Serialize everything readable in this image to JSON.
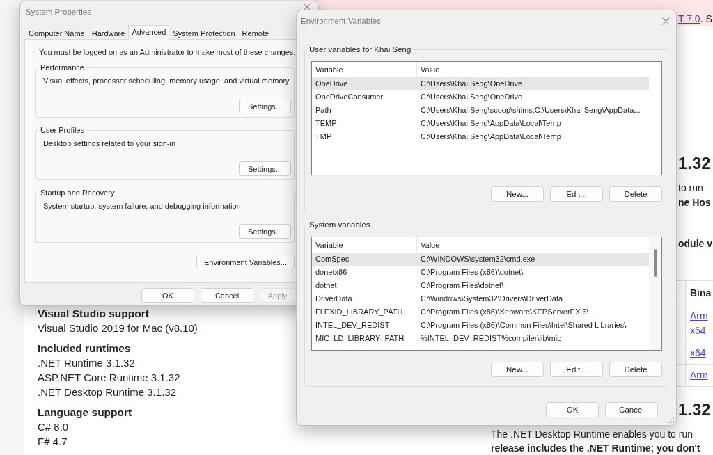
{
  "web_page": {
    "banner": {
      "link": "T 7.0",
      "text": ". S"
    },
    "left_column": [
      {
        "kind": "heading",
        "text": "Visual Studio support"
      },
      {
        "kind": "text",
        "text": "Visual Studio 2019 for Mac (v8.10)"
      },
      {
        "kind": "heading",
        "text": "Included runtimes"
      },
      {
        "kind": "text",
        "text": ".NET Runtime 3.1.32"
      },
      {
        "kind": "text",
        "text": "ASP.NET Core Runtime 3.1.32"
      },
      {
        "kind": "text",
        "text": ".NET Desktop Runtime 3.1.32"
      },
      {
        "kind": "heading",
        "text": "Language support"
      },
      {
        "kind": "text",
        "text": "C# 8.0"
      },
      {
        "kind": "text",
        "text": "F# 4.7"
      }
    ],
    "right_column": [
      {
        "kind": "title",
        "text": "1.32"
      },
      {
        "kind": "text",
        "text": "to run"
      },
      {
        "kind": "bold",
        "text": "ne Hos"
      },
      {
        "kind": "bold",
        "text": "odule v"
      },
      {
        "kind": "table",
        "columns": [
          "Bina"
        ],
        "rows": [
          [
            "Arm",
            "x64"
          ],
          [
            "x64"
          ],
          [
            "Arm"
          ]
        ]
      },
      {
        "kind": "title",
        "text": "1.32"
      }
    ],
    "bottom_lines": [
      {
        "kind": "text",
        "text": "The .NET Desktop Runtime enables you to run"
      },
      {
        "kind": "bold",
        "text": "release includes the .NET Runtime; you don't"
      }
    ]
  },
  "system_properties": {
    "title": "System Properties",
    "tabs": [
      {
        "label": "Computer Name",
        "selected": false
      },
      {
        "label": "Hardware",
        "selected": false
      },
      {
        "label": "Advanced",
        "selected": true
      },
      {
        "label": "System Protection",
        "selected": false
      },
      {
        "label": "Remote",
        "selected": false
      }
    ],
    "notice": "You must be logged on as an Administrator to make most of these changes.",
    "groups": [
      {
        "title": "Performance",
        "description": "Visual effects, processor scheduling, memory usage, and virtual memory",
        "button": "Settings..."
      },
      {
        "title": "User Profiles",
        "description": "Desktop settings related to your sign-in",
        "button": "Settings..."
      },
      {
        "title": "Startup and Recovery",
        "description": "System startup, system failure, and debugging information",
        "button": "Settings..."
      }
    ],
    "panel_button": "Environment Variables...",
    "buttons": [
      {
        "label": "OK",
        "disabled": false
      },
      {
        "label": "Cancel",
        "disabled": false
      },
      {
        "label": "Apply",
        "disabled": true
      }
    ]
  },
  "environment_variables": {
    "title": "Environment Variables",
    "sections": [
      {
        "title": "User variables for Khai Seng",
        "columns": [
          "Variable",
          "Value"
        ],
        "scrollable": false,
        "rows": [
          {
            "variable": "OneDrive",
            "value": "C:\\Users\\Khai Seng\\OneDrive",
            "selected": true
          },
          {
            "variable": "OneDriveConsumer",
            "value": "C:\\Users\\Khai Seng\\OneDrive",
            "selected": false
          },
          {
            "variable": "Path",
            "value": "C:\\Users\\Khai Seng\\scoop\\shims;C:\\Users\\Khai Seng\\AppData...",
            "selected": false
          },
          {
            "variable": "TEMP",
            "value": "C:\\Users\\Khai Seng\\AppData\\Local\\Temp",
            "selected": false
          },
          {
            "variable": "TMP",
            "value": "C:\\Users\\Khai Seng\\AppData\\Local\\Temp",
            "selected": false
          }
        ],
        "buttons": [
          "New...",
          "Edit...",
          "Delete"
        ]
      },
      {
        "title": "System variables",
        "columns": [
          "Variable",
          "Value"
        ],
        "scrollable": true,
        "rows": [
          {
            "variable": "ComSpec",
            "value": "C:\\WINDOWS\\system32\\cmd.exe",
            "selected": true
          },
          {
            "variable": "donetx86",
            "value": "C:\\Program Files (x86)\\dotnet\\",
            "selected": false
          },
          {
            "variable": "dotnet",
            "value": "C:\\Program Files\\dotnet\\",
            "selected": false
          },
          {
            "variable": "DriverData",
            "value": "C:\\Windows\\System32\\Drivers\\DriverData",
            "selected": false
          },
          {
            "variable": "FLEXID_LIBRARY_PATH",
            "value": "C:\\Program Files (x86)\\Kepware\\KEPServerEX 6\\",
            "selected": false
          },
          {
            "variable": "INTEL_DEV_REDIST",
            "value": "C:\\Program Files (x86)\\Common Files\\Intel\\Shared Libraries\\",
            "selected": false
          },
          {
            "variable": "MIC_LD_LIBRARY_PATH",
            "value": "%INTEL_DEV_REDIST%compiler\\lib\\mic",
            "selected": false
          }
        ],
        "buttons": [
          "New...",
          "Edit...",
          "Delete"
        ]
      }
    ],
    "buttons": [
      "OK",
      "Cancel"
    ]
  }
}
